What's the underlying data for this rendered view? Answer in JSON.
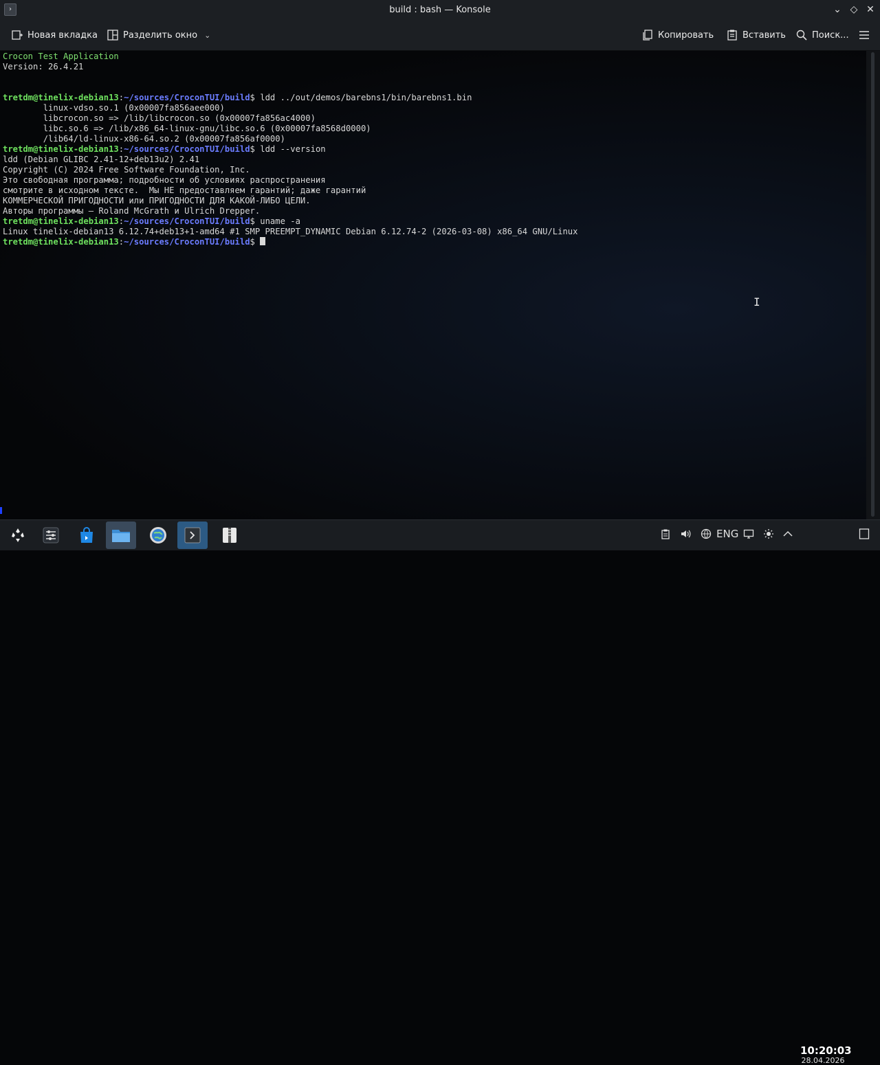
{
  "window": {
    "title": "build : bash — Konsole"
  },
  "toolbar": {
    "new_tab": "Новая вкладка",
    "split_view": "Разделить окно",
    "copy": "Копировать",
    "paste": "Вставить",
    "find": "Поиск..."
  },
  "terminal": {
    "lines": [
      {
        "type": "green",
        "text": "Crocon Test Application"
      },
      {
        "type": "plain",
        "text": "Version: 26.4.21"
      },
      {
        "type": "plain",
        "text": ""
      },
      {
        "type": "plain",
        "text": ""
      },
      {
        "type": "prompt",
        "user": "tretdm@tinelix-debian13",
        "path": "~/sources/CroconTUI/build",
        "cmd": " ldd ../out/demos/barebns1/bin/barebns1.bin"
      },
      {
        "type": "plain",
        "text": "        linux-vdso.so.1 (0x00007fa856aee000)"
      },
      {
        "type": "plain",
        "text": "        libcrocon.so => /lib/libcrocon.so (0x00007fa856ac4000)"
      },
      {
        "type": "plain",
        "text": "        libc.so.6 => /lib/x86_64-linux-gnu/libc.so.6 (0x00007fa8568d0000)"
      },
      {
        "type": "plain",
        "text": "        /lib64/ld-linux-x86-64.so.2 (0x00007fa856af0000)"
      },
      {
        "type": "prompt",
        "user": "tretdm@tinelix-debian13",
        "path": "~/sources/CroconTUI/build",
        "cmd": " ldd --version"
      },
      {
        "type": "plain",
        "text": "ldd (Debian GLIBC 2.41-12+deb13u2) 2.41"
      },
      {
        "type": "plain",
        "text": "Copyright (C) 2024 Free Software Foundation, Inc."
      },
      {
        "type": "plain",
        "text": "Это свободная программа; подробности об условиях распространения"
      },
      {
        "type": "plain",
        "text": "смотрите в исходном тексте.  Мы НЕ предоставляем гарантий; даже гарантий"
      },
      {
        "type": "plain",
        "text": "КОММЕРЧЕСКОЙ ПРИГОДНОСТИ или ПРИГОДНОСТИ ДЛЯ КАКОЙ-ЛИБО ЦЕЛИ."
      },
      {
        "type": "plain",
        "text": "Авторы программы — Roland McGrath и Ulrich Drepper."
      },
      {
        "type": "prompt",
        "user": "tretdm@tinelix-debian13",
        "path": "~/sources/CroconTUI/build",
        "cmd": " uname -a"
      },
      {
        "type": "plain",
        "text": "Linux tinelix-debian13 6.12.74+deb13+1-amd64 #1 SMP PREEMPT_DYNAMIC Debian 6.12.74-2 (2026-03-08) x86_64 GNU/Linux"
      },
      {
        "type": "prompt-cursor",
        "user": "tretdm@tinelix-debian13",
        "path": "~/sources/CroconTUI/build",
        "cmd": " "
      }
    ]
  },
  "taskbar": {
    "items": [
      {
        "name": "app-launcher",
        "icon": "kde-launcher-icon"
      },
      {
        "name": "system-monitor",
        "icon": "sliders-icon"
      },
      {
        "name": "discover-store",
        "icon": "store-bag-icon"
      },
      {
        "name": "file-manager",
        "icon": "folder-icon",
        "state": "active"
      },
      {
        "name": "system-settings",
        "icon": "globe-gear-icon"
      },
      {
        "name": "konsole",
        "icon": "terminal-icon",
        "state": "focused"
      },
      {
        "name": "archiver",
        "icon": "archive-icon"
      }
    ],
    "tray": {
      "keyboard_layout": "ENG"
    },
    "clock": {
      "time": "10:20:03",
      "date": "28.04.2026"
    }
  },
  "colors": {
    "prompt_user": "#6ee05e",
    "prompt_path": "#6b7cff",
    "app_green": "#7fe070",
    "chrome_bg": "#1c1f23",
    "focused_task": "#2c5a84"
  }
}
